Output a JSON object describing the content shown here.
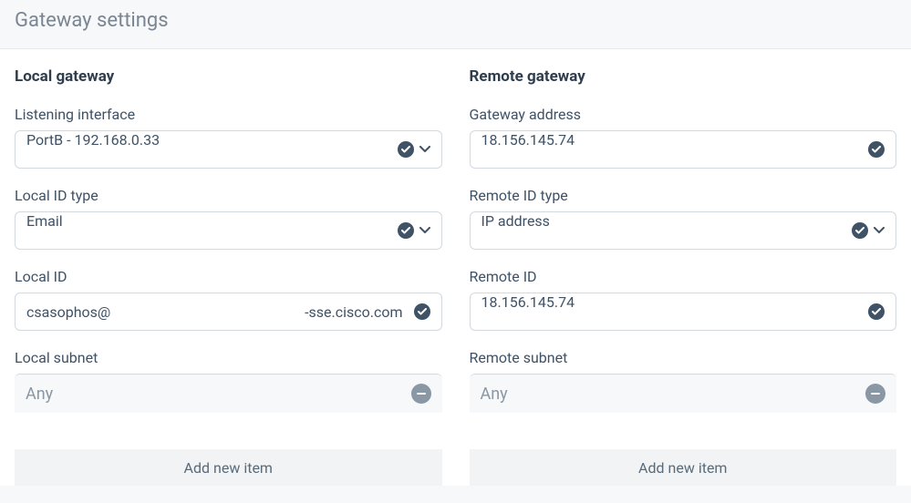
{
  "page": {
    "title": "Gateway settings"
  },
  "local": {
    "section_title": "Local gateway",
    "listening_interface": {
      "label": "Listening interface",
      "value": "PortB - 192.168.0.33"
    },
    "id_type": {
      "label": "Local ID type",
      "value": "Email"
    },
    "id": {
      "label": "Local ID",
      "value_left": "csasophos@",
      "value_right": "-sse.cisco.com"
    },
    "subnet": {
      "label": "Local subnet",
      "items": [
        "Any"
      ],
      "add_label": "Add new item"
    }
  },
  "remote": {
    "section_title": "Remote gateway",
    "address": {
      "label": "Gateway address",
      "value": "18.156.145.74"
    },
    "id_type": {
      "label": "Remote ID type",
      "value": "IP address"
    },
    "id": {
      "label": "Remote ID",
      "value": "18.156.145.74"
    },
    "subnet": {
      "label": "Remote subnet",
      "items": [
        "Any"
      ],
      "add_label": "Add new item"
    }
  }
}
